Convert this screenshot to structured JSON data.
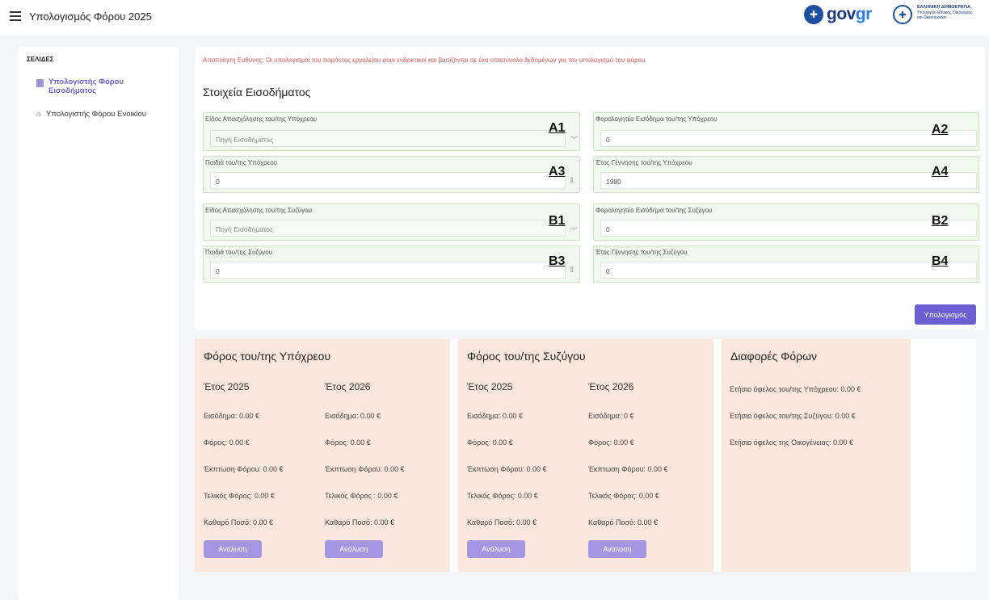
{
  "header": {
    "title": "Υπολογισμός Φόρου 2025",
    "govgr_left": "gov",
    "govgr_right": "gr",
    "ministry_line1": "ΕΛΛΗΝΙΚΗ ΔΗΜΟΚΡΑΤΙΑ",
    "ministry_line2": "Υπουργείο Εθνικής Οικονομίας",
    "ministry_line3": "και Οικονομικών"
  },
  "sidebar": {
    "heading": "ΣΕΛΙΔΕΣ",
    "items": [
      {
        "label": "Υπολογιστής Φόρου Εισοδήματος",
        "active": true
      },
      {
        "label": "Υπολογιστής Φόρου Ενοικίου",
        "active": false
      }
    ]
  },
  "form": {
    "disclaimer": "Αποποίηση Ευθύνης: Οι υπολογισμοί του παρόντος εργαλείου είναι ενδεικτικοί και βασίζονται σε ένα υποσύνολο δεδομένων για τον υπολογισμό του φόρου.",
    "section_title": "Στοιχεία Εισοδήματος",
    "fields": {
      "a1": {
        "label": "Είδος Απασχόλησης του/της Υπόχρεου",
        "value": "Πηγή Εισοδήματος",
        "tag": "A1"
      },
      "a2": {
        "label": "Φορολογητέο Εισόδημα του/της Υπόχρεου",
        "value": "0",
        "tag": "A2"
      },
      "a3": {
        "label": "Παιδιά του/της Υπόχρεου",
        "value": "0",
        "tag": "A3"
      },
      "a4": {
        "label": "Έτος Γέννησης του/της Υπόχρεου",
        "value": "1980",
        "tag": "A4"
      },
      "b1": {
        "label": "Είδος Απασχόλησης του/της Συζύγου",
        "value": "Πηγή Εισοδήματος",
        "tag": "B1"
      },
      "b2": {
        "label": "Φορολογητέο Εισόδημα του/της Συζύγου",
        "value": "0",
        "tag": "B2"
      },
      "b3": {
        "label": "Παιδιά του/της Συζύγου",
        "value": "0",
        "tag": "B3"
      },
      "b4": {
        "label": "Έτος Γέννησης του/της Συζύγου",
        "value": "0",
        "tag": "B4"
      }
    },
    "calculate_label": "Υπολογισμός"
  },
  "results": {
    "taxpayer": {
      "title": "Φόρος του/της Υπόχρεου",
      "y2025": {
        "year": "Έτος 2025",
        "income": "Εισόδημα: 0.00 €",
        "tax": "Φόρος: 0.00 €",
        "discount": "Έκπτωση Φόρου: 0.00 €",
        "final": "Τελικός Φόρος: 0.00 €",
        "net": "Καθαρό Ποσό: 0.00 €",
        "button": "Ανάλυση"
      },
      "y2026": {
        "year": "Έτος 2026",
        "income": "Εισόδημα: 0.00 €",
        "tax": "Φόρος: 0.00 €",
        "discount": "Έκπτωση Φόρου: 0.00 €",
        "final": "Τελικός Φόρος : 0.00 €",
        "net": "Καθαρό Ποσό: 0.00 €",
        "button": "Ανάλυση"
      }
    },
    "spouse": {
      "title": "Φόρος του/της Συζύγου",
      "y2025": {
        "year": "Έτος 2025",
        "income": "Εισόδημα: 0.00 €",
        "tax": "Φόρος: 0.00 €",
        "discount": "Έκπτωση Φόρου: 0.00 €",
        "final": "Τελικός Φόρος: 0.00 €",
        "net": "Καθαρό Ποσό: 0.00 €",
        "button": "Ανάλυση"
      },
      "y2026": {
        "year": "Έτος 2026",
        "income": "Εισόδημα: 0 €",
        "tax": "Φόρος: 0.00 €",
        "discount": "Έκπτωση Φόρου: 0.00 €",
        "final": "Τελικός Φόρος: 0.00 €",
        "net": "Καθαρό Ποσό: 0.00 €",
        "button": "Ανάλυση"
      }
    },
    "differences": {
      "title": "Διαφορές Φόρων",
      "taxpayer_benefit": "Ετήσιο όφελος του/της Υπόχρεου: 0.00 €",
      "spouse_benefit": "Ετήσιο όφελος του/της Συζύγου: 0.00 €",
      "family_benefit": "Ετήσιο όφελος της Οικογένειας: 0.00 €"
    }
  },
  "colors": {
    "accent": "#6b5fd3",
    "analysis_button": "#a596e4",
    "panel_bg": "#fbe7dd",
    "field_bg": "#f1f9ee",
    "disclaimer": "#e45353"
  }
}
